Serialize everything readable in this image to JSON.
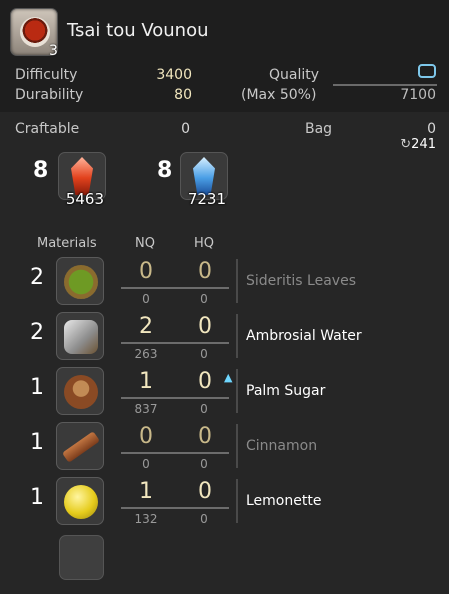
{
  "item": {
    "name": "Tsai tou Vounou",
    "yield": "3",
    "icon": "tea-cup-icon"
  },
  "stats": {
    "difficulty_label": "Difficulty",
    "difficulty_value": "3400",
    "durability_label": "Durability",
    "durability_value": "80",
    "quality_label": "Quality",
    "quality_value": "0",
    "max_label": "(Max 50%)",
    "max_value": "7100",
    "quality_fill": 0,
    "craftable_label": "Craftable",
    "craftable_value": "0",
    "bag_label": "Bag",
    "bag_value": "0",
    "bag_total": "241"
  },
  "crystals": [
    {
      "required": "8",
      "have": "5463",
      "icon": "fire-crystal-icon"
    },
    {
      "required": "8",
      "have": "7231",
      "icon": "water-crystal-icon"
    }
  ],
  "materials_header": {
    "materials": "Materials",
    "nq": "NQ",
    "hq": "HQ"
  },
  "materials": [
    {
      "qty": "2",
      "nq": "0",
      "hq": "0",
      "nq_have": "0",
      "hq_have": "0",
      "name": "Sideritis Leaves",
      "available": false,
      "icon": "leaves-bowl-icon"
    },
    {
      "qty": "2",
      "nq": "2",
      "hq": "0",
      "nq_have": "263",
      "hq_have": "0",
      "name": "Ambrosial Water",
      "available": true,
      "icon": "water-flask-icon"
    },
    {
      "qty": "1",
      "nq": "1",
      "hq": "0",
      "nq_have": "837",
      "hq_have": "0",
      "name": "Palm Sugar",
      "available": true,
      "icon": "sugar-pot-icon"
    },
    {
      "qty": "1",
      "nq": "0",
      "hq": "0",
      "nq_have": "0",
      "hq_have": "0",
      "name": "Cinnamon",
      "available": false,
      "icon": "cinnamon-icon"
    },
    {
      "qty": "1",
      "nq": "1",
      "hq": "0",
      "nq_have": "132",
      "hq_have": "0",
      "name": "Lemonette",
      "available": true,
      "icon": "lemon-icon"
    }
  ],
  "colors": {
    "value_yellow": "#f2e7bf",
    "quality_blue": "#7ec7ea",
    "hq_arrow": "#6fd7ff"
  }
}
